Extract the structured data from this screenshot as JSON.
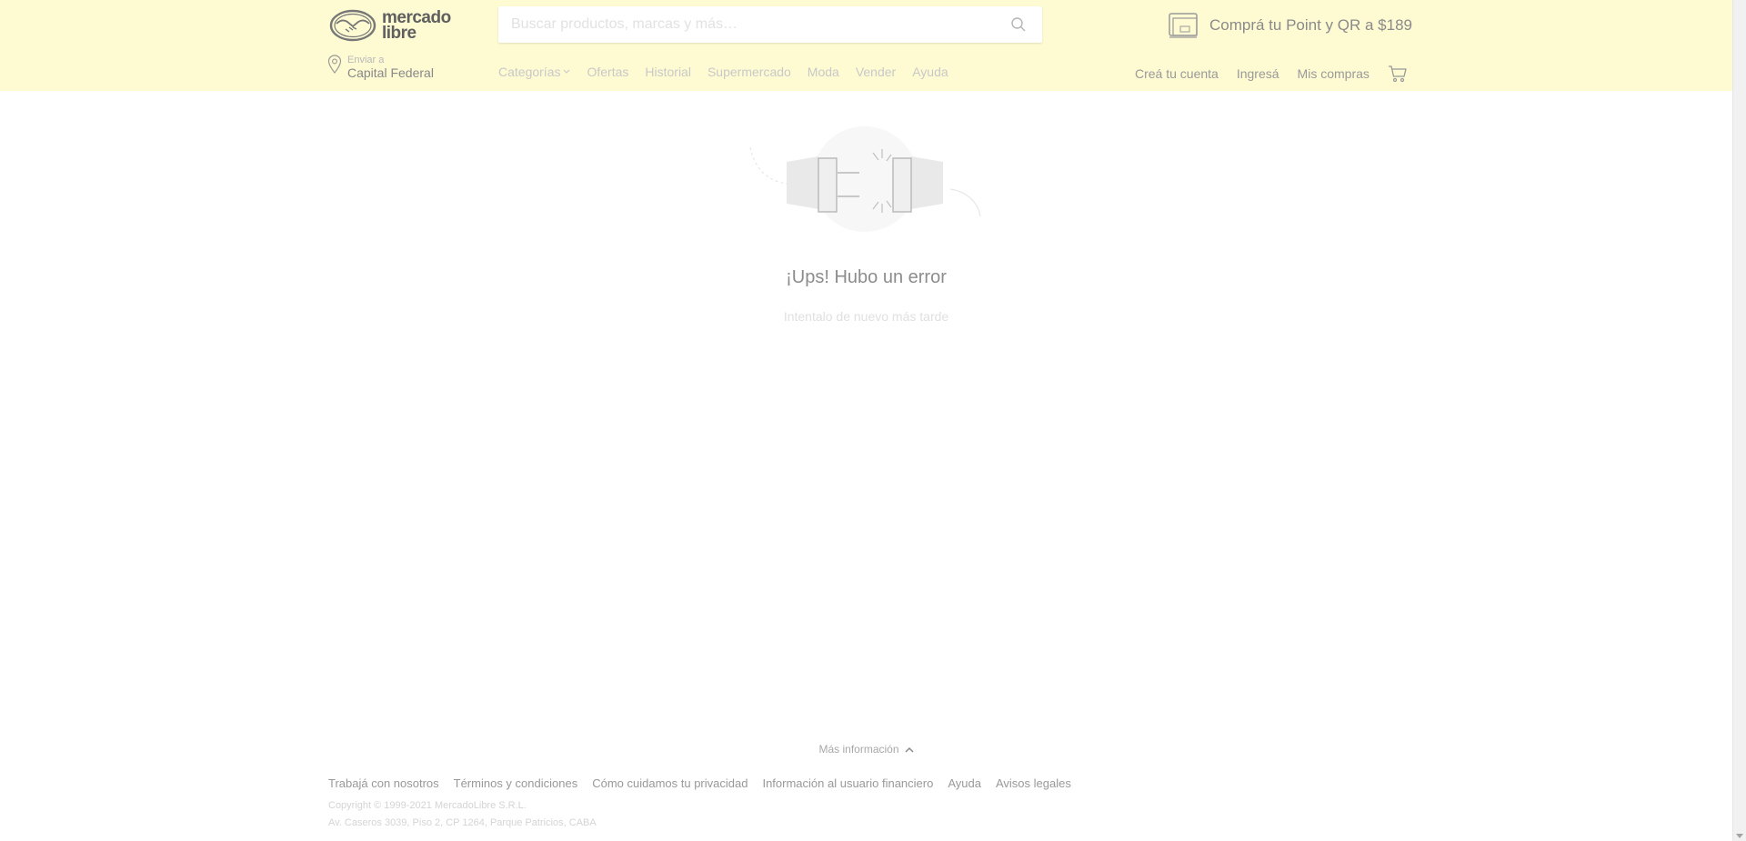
{
  "header": {
    "logo_line1": "mercado",
    "logo_line2": "libre",
    "search": {
      "placeholder": "Buscar productos, marcas y más…",
      "value": ""
    },
    "promo_text": "Comprá tu Point y QR a $189",
    "location": {
      "label": "Enviar a",
      "value": "Capital Federal"
    },
    "nav": [
      {
        "label": "Categorías"
      },
      {
        "label": "Ofertas"
      },
      {
        "label": "Historial"
      },
      {
        "label": "Supermercado"
      },
      {
        "label": "Moda"
      },
      {
        "label": "Vender"
      },
      {
        "label": "Ayuda"
      }
    ],
    "user_nav": [
      {
        "label": "Creá tu cuenta"
      },
      {
        "label": "Ingresá"
      },
      {
        "label": "Mis compras"
      }
    ],
    "cart_icon": "cart-icon"
  },
  "error": {
    "title": "¡Ups! Hubo un error",
    "subtitle": "Intentalo de nuevo más tarde"
  },
  "footer": {
    "more_info": "Más información",
    "links": [
      {
        "label": "Trabajá con nosotros"
      },
      {
        "label": "Términos y condiciones"
      },
      {
        "label": "Cómo cuidamos tu privacidad"
      },
      {
        "label": "Información al usuario financiero"
      },
      {
        "label": "Ayuda"
      },
      {
        "label": "Avisos legales"
      }
    ],
    "copyright": "Copyright © 1999-2021 MercadoLibre S.R.L.",
    "address": "Av. Caseros 3039, Piso 2, CP 1264, Parque Patricios, CABA"
  },
  "colors": {
    "header_bg": "#fefbd3",
    "text": "#666666"
  }
}
